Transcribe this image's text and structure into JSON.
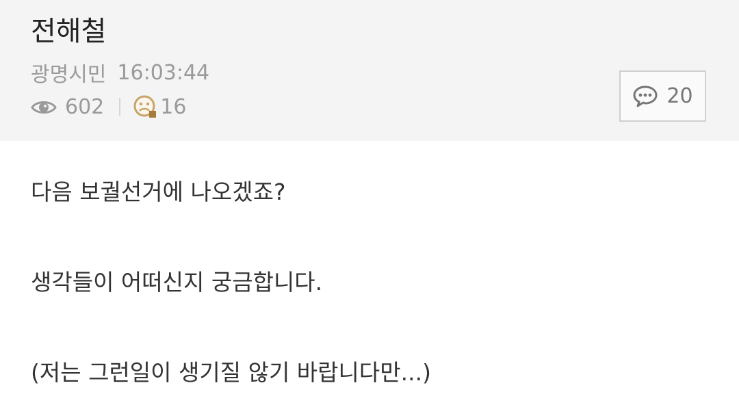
{
  "post": {
    "title": "전해철",
    "author": "광명시민",
    "time": "16:03:44",
    "views": "602",
    "recommends": "16",
    "comments": "20"
  },
  "body": {
    "paragraphs": [
      "다음 보궐선거에 나오겠죠?",
      "생각들이 어떠신지 궁금합니다.",
      "(저는 그런일이 생기질 않기 바랍니다만...)"
    ]
  },
  "icons": {
    "views": "eye-icon",
    "recommends": "recommend-icon",
    "comments": "comment-bubble-icon"
  },
  "colors": {
    "header_background": "#f4f4f4",
    "meta_text": "#9a9a9a",
    "title_text": "#222222",
    "body_text": "#333333",
    "recommend_icon": "#c9a46a"
  }
}
